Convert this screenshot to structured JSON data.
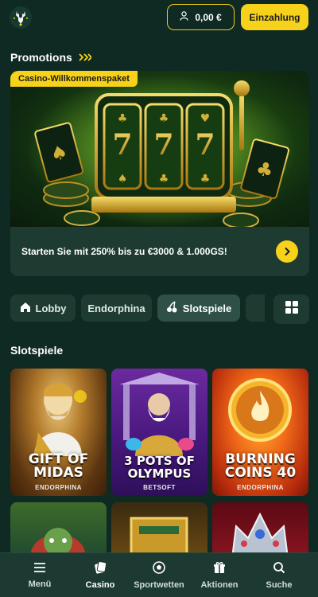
{
  "header": {
    "balance": "0,00 €",
    "deposit_label": "Einzahlung"
  },
  "promotions": {
    "title": "Promotions",
    "badge": "Casino-Willkommenspaket",
    "text": "Starten Sie mit 250% bis zu €3000 & 1.000GS!"
  },
  "tabs": [
    {
      "label": "Lobby",
      "icon": "house-icon"
    },
    {
      "label": "Endorphina",
      "icon": ""
    },
    {
      "label": "Slotspiele",
      "icon": "cherry-icon"
    }
  ],
  "slots": {
    "title": "Slotspiele",
    "games": [
      {
        "name_line1": "GIFT OF",
        "name_line2": "MIDAS",
        "provider": "ENDORPHINA"
      },
      {
        "name_line1": "3 POTS OF",
        "name_line2": "OLYMPUS",
        "provider": "BETSOFT"
      },
      {
        "name_line1": "BURNING",
        "name_line2": "COINS 40",
        "provider": "ENDORPHINA"
      }
    ]
  },
  "nav": [
    {
      "label": "Menü",
      "icon": "menu-icon"
    },
    {
      "label": "Casino",
      "icon": "casino-icon"
    },
    {
      "label": "Sportwetten",
      "icon": "football-icon"
    },
    {
      "label": "Aktionen",
      "icon": "gift-icon"
    },
    {
      "label": "Suche",
      "icon": "search-icon"
    }
  ],
  "colors": {
    "background": "#0f2a22",
    "accent": "#f6d21a",
    "card": "#1e3b32"
  }
}
